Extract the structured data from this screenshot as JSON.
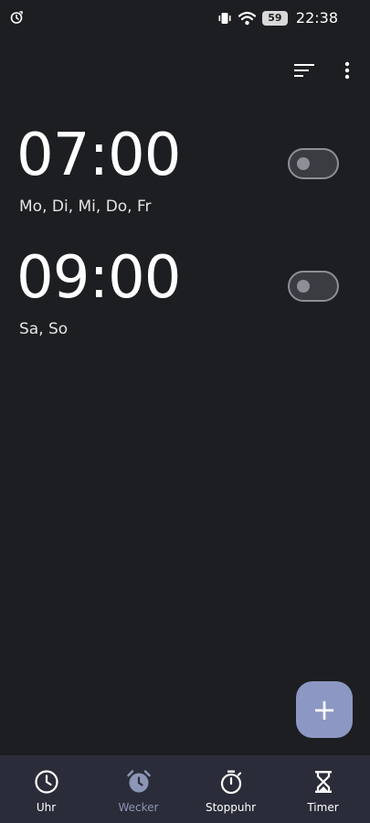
{
  "status_bar": {
    "time": "22:38",
    "battery_level": "59",
    "left_icon": "alarm-sync-icon",
    "right_icons": [
      "vibrate-icon",
      "wifi-icon",
      "battery-icon"
    ]
  },
  "toolbar": {
    "sort_icon": "sort-icon",
    "more_icon": "more-vert-icon"
  },
  "alarms": [
    {
      "time": "07:00",
      "days": "Mo, Di, Mi, Do, Fr",
      "enabled": false
    },
    {
      "time": "09:00",
      "days": "Sa, So",
      "enabled": false
    }
  ],
  "fab": {
    "label": "+",
    "icon": "add-icon"
  },
  "bottom_nav": {
    "items": [
      {
        "label": "Uhr",
        "icon": "clock-icon",
        "active": false
      },
      {
        "label": "Wecker",
        "icon": "alarm-icon",
        "active": true
      },
      {
        "label": "Stoppuhr",
        "icon": "stopwatch-icon",
        "active": false
      },
      {
        "label": "Timer",
        "icon": "hourglass-icon",
        "active": false
      }
    ]
  },
  "colors": {
    "background": "#1d1e22",
    "nav_background": "#2a2d39",
    "accent": "#8c97c3",
    "active_nav": "#8d95b5",
    "toggle_off": "#8d8f96"
  }
}
